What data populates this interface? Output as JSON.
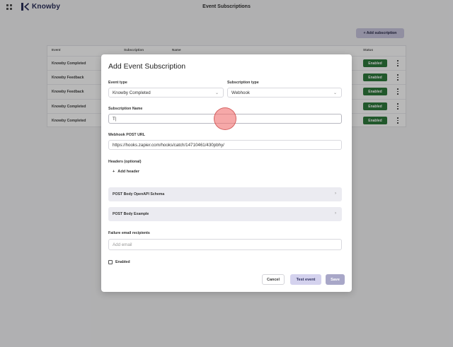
{
  "app": {
    "logo_text": "Knowby",
    "page_title": "Event Subscriptions"
  },
  "toolbar": {
    "add_subscription_label": "+ Add subscription"
  },
  "table": {
    "headers": {
      "event": "Event",
      "subscription_type": "Subscription",
      "name": "Name",
      "status": "Status"
    },
    "rows": [
      {
        "event": "Knowby Completed",
        "status": "Enabled"
      },
      {
        "event": "Knowby Feedback",
        "status": "Enabled"
      },
      {
        "event": "Knowby Feedback",
        "status": "Enabled"
      },
      {
        "event": "Knowby Completed",
        "status": "Enabled"
      },
      {
        "event": "Knowby Completed",
        "status": "Enabled"
      }
    ]
  },
  "modal": {
    "title": "Add Event Subscription",
    "event_type_label": "Event type",
    "event_type_value": "Knowby Completed",
    "subscription_type_label": "Subscription type",
    "subscription_type_value": "Webhook",
    "subscription_name_label": "Subscription Name",
    "subscription_name_value": "T",
    "webhook_url_label": "Webhook POST URL",
    "webhook_url_value": "https://hooks.zapier.com/hooks/catch/14710461/430pbhy/",
    "headers_label": "Headers (optional)",
    "add_header_label": "Add header",
    "schema_label": "POST Body OpenAPI Schema",
    "example_label": "POST Body Example",
    "failure_label": "Failure email recipients",
    "failure_placeholder": "Add email",
    "enabled_label": "Enabled",
    "cancel_label": "Cancel",
    "test_label": "Test event",
    "save_label": "Save"
  },
  "colors": {
    "accent": "#c9c6df",
    "enabled_badge": "#2f7a3c",
    "brand": "#2a2f5a"
  }
}
